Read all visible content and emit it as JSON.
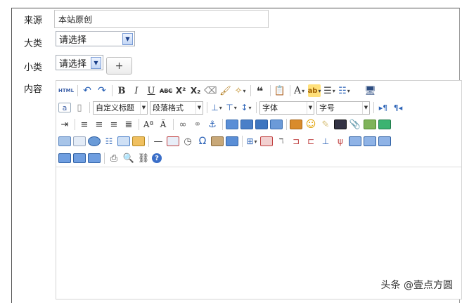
{
  "form": {
    "source_label": "来源",
    "source_value": "本站原创",
    "category_label": "大类",
    "category_selected": "请选择",
    "subcategory_label": "小类",
    "subcategory_selected": "请选择",
    "add_label": "+",
    "content_label": "内容"
  },
  "editor": {
    "html_label": "HTML",
    "custom_heading": "自定义标题",
    "paragraph_format": "段落格式",
    "font_family": "字体",
    "font_size": "字号"
  },
  "watermark": "头条 @壹点方圆"
}
